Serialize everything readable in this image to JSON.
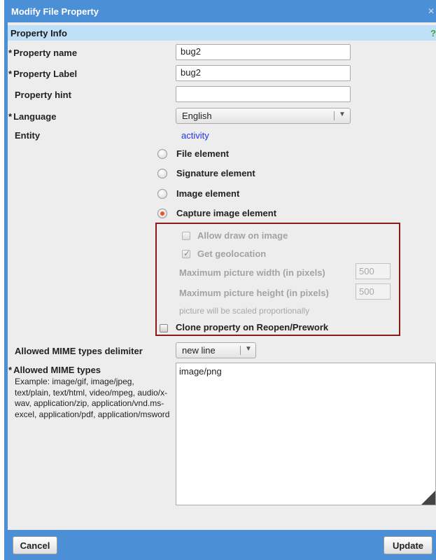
{
  "dialog": {
    "title": "Modify File Property",
    "close_icon": "close-icon"
  },
  "section": {
    "title": "Property Info",
    "help": "?"
  },
  "fields": {
    "required_mark": "*",
    "property_name": {
      "label": "Property name",
      "value": "bug2"
    },
    "property_label": {
      "label": "Property Label",
      "value": "bug2"
    },
    "property_hint": {
      "label": "Property hint",
      "value": ""
    },
    "language": {
      "label": "Language",
      "value": "English"
    },
    "entity": {
      "label": "Entity",
      "value": "activity"
    }
  },
  "element_types": [
    {
      "label": "File element",
      "checked": false
    },
    {
      "label": "Signature element",
      "checked": false
    },
    {
      "label": "Image element",
      "checked": false
    },
    {
      "label": "Capture image element",
      "checked": true
    }
  ],
  "capture_options": {
    "allow_draw": {
      "label": "Allow draw on image",
      "checked": false,
      "disabled": true
    },
    "get_geolocation": {
      "label": "Get geolocation",
      "checked": true,
      "disabled": true
    },
    "max_width": {
      "label": "Maximum picture width (in pixels)",
      "value": "500"
    },
    "max_height": {
      "label": "Maximum picture height (in pixels)",
      "value": "500"
    },
    "scale_note": "picture will be scaled proportionally",
    "clone_property": {
      "label": "Clone property on Reopen/Prework",
      "checked": false
    }
  },
  "mime": {
    "delimiter_label": "Allowed MIME types delimiter",
    "delimiter_value": "new line",
    "types_label": "Allowed MIME types",
    "example": "Example: image/gif, image/jpeg, text/plain, text/html, video/mpeg, audio/x-wav, application/zip, application/vnd.ms-excel, application/pdf, application/msword",
    "types_value": "image/png"
  },
  "buttons": {
    "cancel": "Cancel",
    "update": "Update"
  },
  "colors": {
    "dialog_blue": "#4b8fd6",
    "header_bg": "#bfe0f7",
    "highlight_border": "#8a1b1b",
    "link": "#2233ee",
    "radio_selected": "#e8541c"
  }
}
